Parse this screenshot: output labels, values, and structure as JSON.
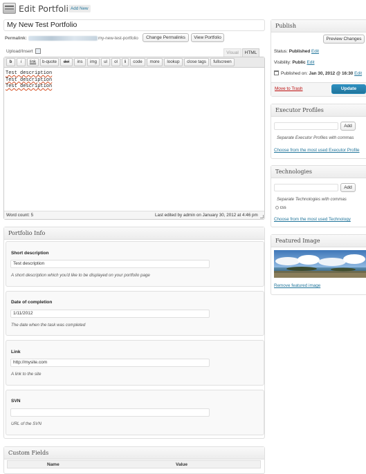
{
  "header": {
    "title": "Edit Portfolio",
    "add_new": "Add New",
    "icon": "portfolio-icon"
  },
  "post": {
    "title": "My New Test Portfolio",
    "permalink_label": "Permalink:",
    "permalink_slug": "my-new-test-portfolio",
    "change_permalinks": "Change Permalinks",
    "view_portfolio": "View Portfolio"
  },
  "editor": {
    "upload_insert": "Upload/Insert",
    "tab_visual": "Visual",
    "tab_html": "HTML",
    "toolbar": [
      "b",
      "i",
      "link",
      "b-quote",
      "del",
      "ins",
      "img",
      "ul",
      "ol",
      "li",
      "code",
      "more",
      "lookup",
      "close tags",
      "fullscreen"
    ],
    "content_lines": [
      "Test description",
      "Test description",
      "Test description"
    ],
    "word_count": "Word count: 5",
    "last_edited": "Last edited by admin on January 30, 2012 at 4:46 pm"
  },
  "portfolio_info": {
    "title": "Portfolio Info",
    "fields": [
      {
        "label": "Short description",
        "value": "Test description",
        "desc": "A short description which you'd like to be displayed on your portfolio page"
      },
      {
        "label": "Date of completion",
        "value": "1/11/2012",
        "desc": "The date when the task was completed"
      },
      {
        "label": "Link",
        "value": "http://mysite.com",
        "desc": "A link to the site"
      },
      {
        "label": "SVN",
        "value": "",
        "desc": "URL of the SVN"
      }
    ]
  },
  "custom_fields": {
    "title": "Custom Fields",
    "col_name": "Name",
    "col_value": "Value"
  },
  "publish": {
    "title": "Publish",
    "preview": "Preview Changes",
    "status_label": "Status:",
    "status_value": "Published",
    "visibility_label": "Visibility:",
    "visibility_value": "Public",
    "published_label": "Published on:",
    "published_value": "Jan 30, 2012 @ 16:30",
    "edit": "Edit",
    "trash": "Move to Trash",
    "update": "Update"
  },
  "executor_profiles": {
    "title": "Executor Profiles",
    "add": "Add",
    "hint": "Separate Executor Profiles with commas",
    "choose": "Choose from the most used Executor Profile"
  },
  "technologies": {
    "title": "Technologies",
    "add": "Add",
    "hint": "Separate Technologies with commas",
    "tag": "css",
    "choose": "Choose from the most used Technology"
  },
  "featured_image": {
    "title": "Featured Image",
    "remove": "Remove featured image"
  },
  "colors": {
    "link": "#21759b",
    "update_button": "#21759b",
    "trash": "#bc0b0b"
  }
}
